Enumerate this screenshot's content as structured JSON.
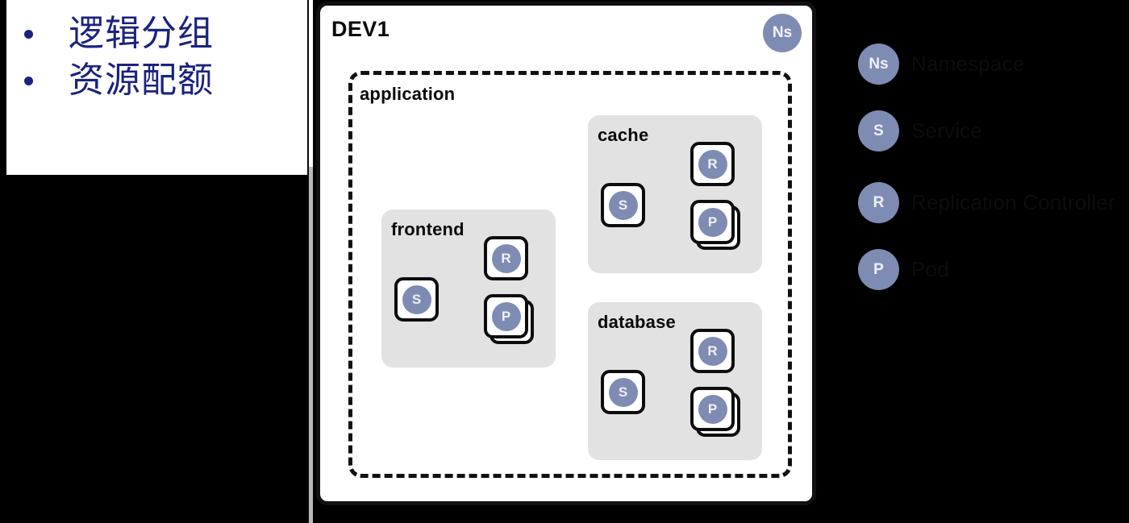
{
  "slide": {
    "bullets": [
      {
        "text": "逻辑分组"
      },
      {
        "text": "资源配额"
      }
    ],
    "text_color": "#1a237e",
    "bullet_color": "#1a237e"
  },
  "namespace": {
    "title": "DEV1",
    "badge_label": "Ns",
    "badge_color": "#7e8cb3"
  },
  "application": {
    "label": "application"
  },
  "groups": [
    {
      "name": "frontend",
      "tiles": [
        {
          "letter": "S",
          "kind": "service",
          "stacked": false
        },
        {
          "letter": "R",
          "kind": "replication-controller",
          "stacked": false
        },
        {
          "letter": "P",
          "kind": "pod",
          "stacked": true
        }
      ]
    },
    {
      "name": "cache",
      "tiles": [
        {
          "letter": "S",
          "kind": "service",
          "stacked": false
        },
        {
          "letter": "R",
          "kind": "replication-controller",
          "stacked": false
        },
        {
          "letter": "P",
          "kind": "pod",
          "stacked": true
        }
      ]
    },
    {
      "name": "database",
      "tiles": [
        {
          "letter": "S",
          "kind": "service",
          "stacked": false
        },
        {
          "letter": "R",
          "kind": "replication-controller",
          "stacked": false
        },
        {
          "letter": "P",
          "kind": "pod",
          "stacked": true
        }
      ]
    }
  ],
  "legend": {
    "items": [
      {
        "symbol": "Ns",
        "label": "Namespace"
      },
      {
        "symbol": "S",
        "label": "Service"
      },
      {
        "symbol": "R",
        "label": "Replication Controller"
      },
      {
        "symbol": "P",
        "label": "Pod"
      }
    ],
    "symbol_color": "#7e8cb3",
    "label_color": "#0d0d0d"
  },
  "colors": {
    "group_fill": "#e2e2e2",
    "tile_border": "#0d0d0d",
    "box_border": "#111111",
    "canvas_background": "#000000",
    "slide_background": "#ffffff"
  }
}
